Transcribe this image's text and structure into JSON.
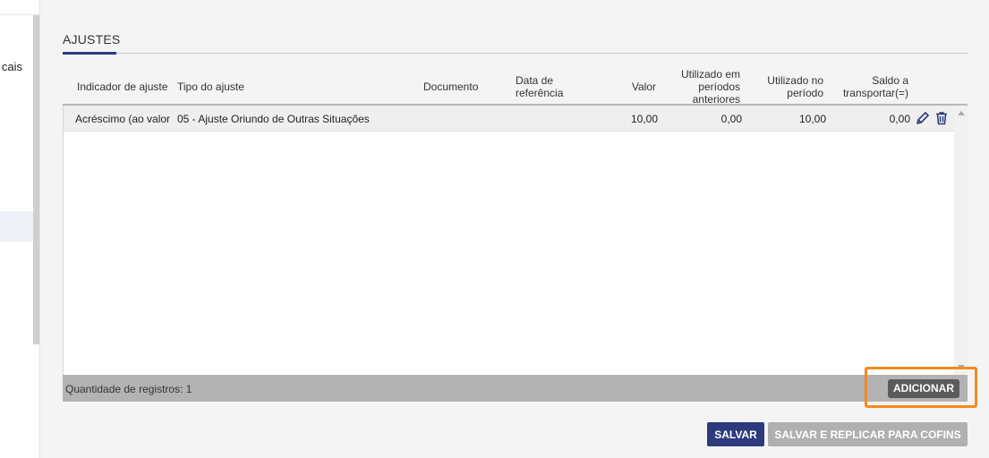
{
  "sidebar": {
    "truncated_label": "cais"
  },
  "section": {
    "title": "AJUSTES"
  },
  "grid": {
    "columns": {
      "indicador": "Indicador de ajuste",
      "tipo": "Tipo do ajuste",
      "documento": "Documento",
      "data_ref_1": "Data de",
      "data_ref_2": "referência",
      "valor": "Valor",
      "utilizado_ant_1": "Utilizado em",
      "utilizado_ant_2": "períodos",
      "utilizado_ant_3": "anteriores",
      "utilizado_per_1": "Utilizado no",
      "utilizado_per_2": "período",
      "saldo_1": "Saldo a",
      "saldo_2": "transportar(=)"
    },
    "rows": [
      {
        "indicador": "Acréscimo (ao valor",
        "tipo": "05 - Ajuste Oriundo de Outras Situações",
        "documento": "",
        "data_ref": "",
        "valor": "10,00",
        "utilizado_ant": "0,00",
        "utilizado_per": "10,00",
        "saldo": "0,00",
        "edit_icon": "pencil-icon",
        "delete_icon": "trash-icon"
      }
    ],
    "footer": {
      "count_label": "Quantidade de registros: 1",
      "add_label": "ADICIONAR"
    }
  },
  "actions": {
    "save_label": "SALVAR",
    "save_replicate_label": "SALVAR E REPLICAR PARA COFINS"
  },
  "colors": {
    "primary": "#2d3a7c",
    "disabled": "#b0b0b0",
    "highlight": "#f58a1f",
    "add_button": "#5b5b5b",
    "footer_bar": "#b3b3b3"
  }
}
